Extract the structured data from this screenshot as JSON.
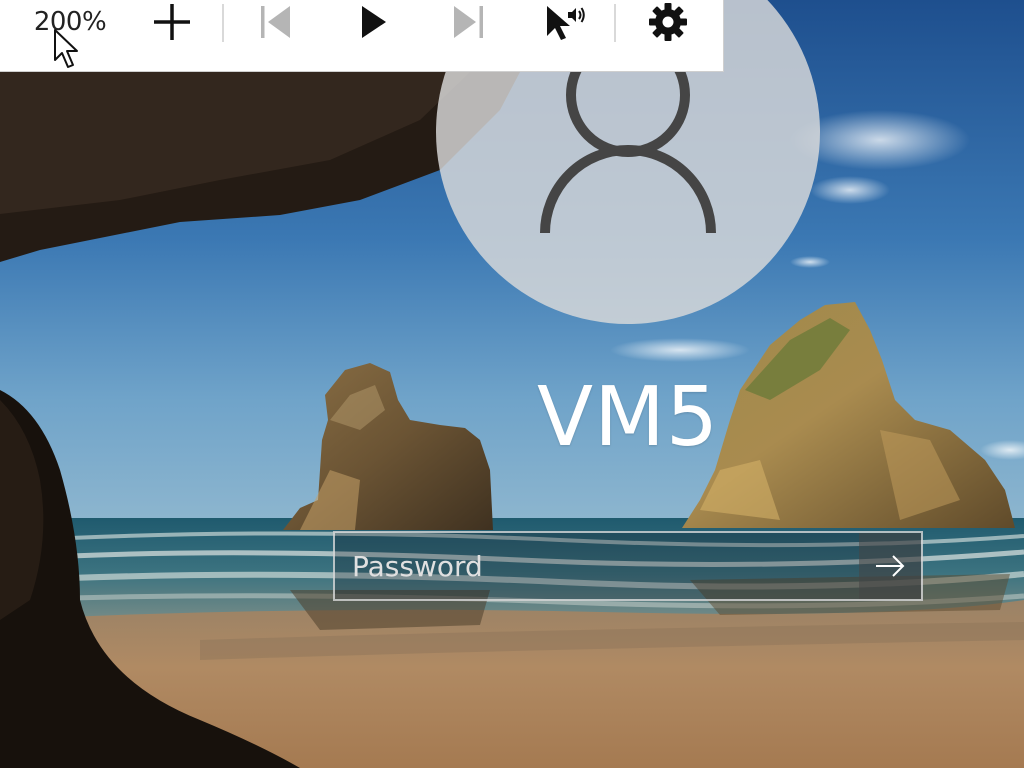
{
  "toolbar": {
    "zoom_level": "200%",
    "zoom_in_icon": "plus-icon",
    "previous_icon": "skip-previous-icon",
    "play_icon": "play-icon",
    "next_icon": "skip-next-icon",
    "pointer_audio_icon": "pointer-with-sound-icon",
    "settings_icon": "gear-icon"
  },
  "login": {
    "avatar_icon": "user-silhouette-icon",
    "username": "VM5",
    "password": {
      "value": "",
      "placeholder": "Password"
    },
    "submit_icon": "arrow-right-icon"
  },
  "colors": {
    "toolbar_bg": "#ffffff",
    "icon_active": "#111111",
    "icon_disabled": "#b5b5b5",
    "avatar_bg": "#dadada",
    "text_white": "#ffffff"
  }
}
